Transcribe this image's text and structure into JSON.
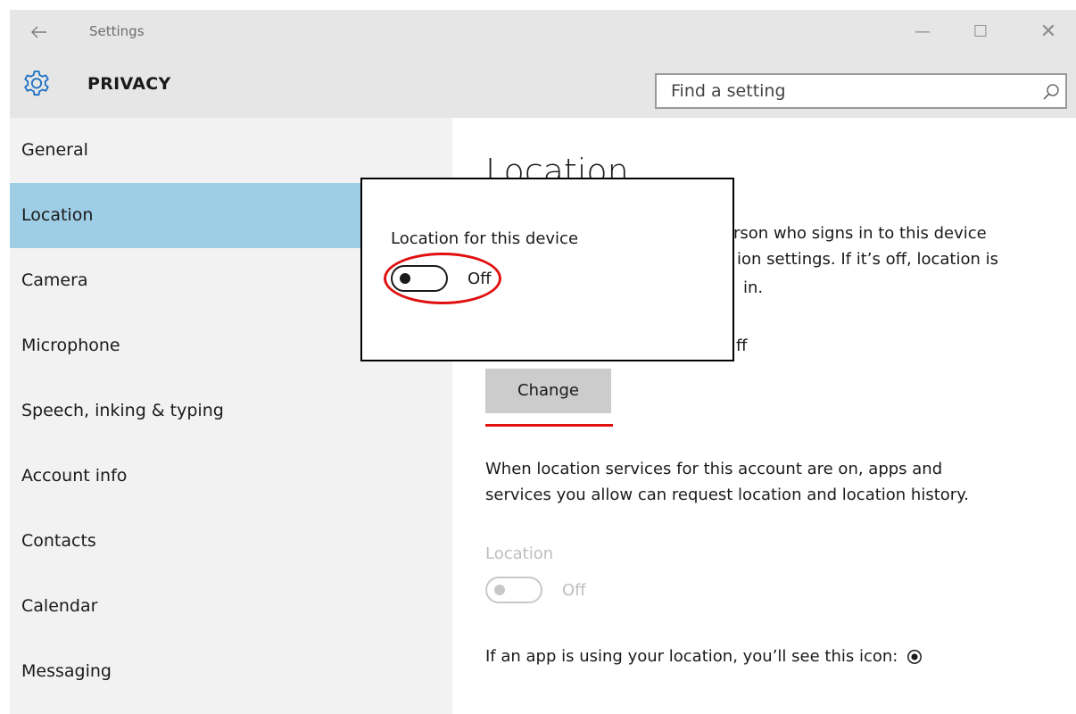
{
  "window": {
    "title": "Settings",
    "back_icon": "back-arrow-icon",
    "controls": {
      "minimize": "—",
      "maximize": "☐",
      "close": "✕"
    }
  },
  "header": {
    "icon": "gear-icon",
    "title": "PRIVACY",
    "search_placeholder": "Find a setting",
    "search_value": ""
  },
  "sidebar": {
    "items": [
      {
        "label": "General"
      },
      {
        "label": "Location",
        "selected": true
      },
      {
        "label": "Camera"
      },
      {
        "label": "Microphone"
      },
      {
        "label": "Speech, inking & typing"
      },
      {
        "label": "Account info"
      },
      {
        "label": "Contacts"
      },
      {
        "label": "Calendar"
      },
      {
        "label": "Messaging"
      }
    ]
  },
  "main": {
    "title": "Location",
    "description_lines": [
      "rson who signs in to this device",
      "ion settings. If it’s off, location is",
      "in."
    ],
    "status_fragment": "ff",
    "change_button": "Change",
    "account_description_lines": [
      "When location services for this account are on, apps and",
      "services you allow can request location and location history."
    ],
    "location_label": "Location",
    "location_toggle_state": "Off",
    "icon_note": "If an app is using your location, you’ll see this icon:"
  },
  "popup": {
    "title": "Location for this device",
    "toggle_state": "Off"
  },
  "colors": {
    "selected_nav": "#9ecde6",
    "highlight_red": "#e01010",
    "chrome_gray": "#e6e6e6",
    "sidebar_bg": "#f2f2f2"
  }
}
